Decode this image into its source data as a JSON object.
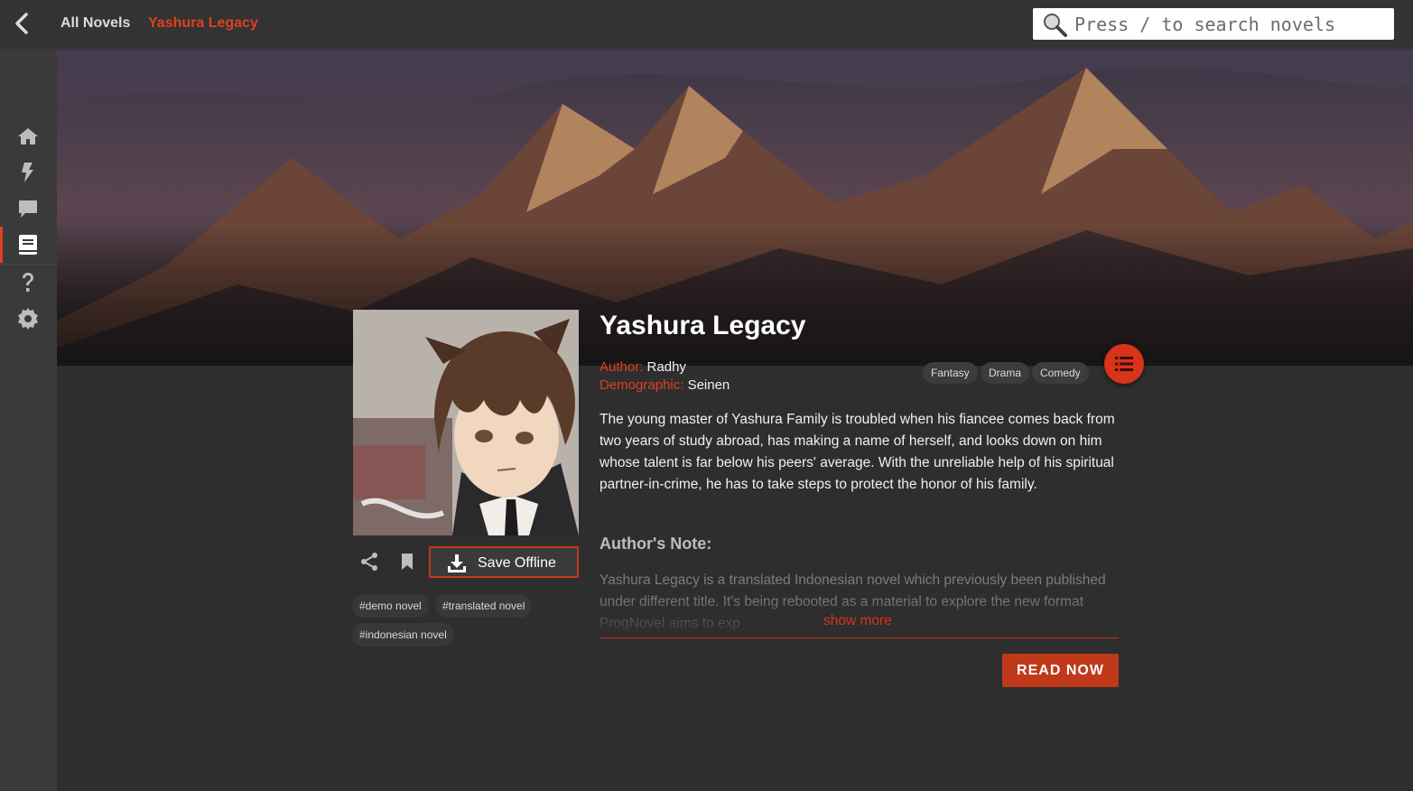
{
  "topbar": {
    "back_icon": "chevron-left-icon",
    "breadcrumb": {
      "all": "All Novels",
      "current": "Yashura Legacy"
    },
    "search": {
      "placeholder": "Press / to search novels",
      "value": ""
    }
  },
  "sidebar": {
    "items": [
      {
        "name": "home",
        "icon": "home-icon"
      },
      {
        "name": "updates",
        "icon": "lightning-icon"
      },
      {
        "name": "comments",
        "icon": "chat-icon"
      },
      {
        "name": "novels",
        "icon": "book-icon",
        "active": true
      },
      {
        "name": "help",
        "icon": "question-icon"
      },
      {
        "name": "settings",
        "icon": "gear-icon"
      }
    ]
  },
  "novel": {
    "title": "Yashura Legacy",
    "author_label": "Author:",
    "author": "Radhy",
    "demographic_label": "Demographic:",
    "demographic": "Seinen",
    "genres": [
      "Fantasy",
      "Drama",
      "Comedy"
    ],
    "synopsis": "The young master of Yashura Family is troubled when his fiancee comes back from two years of study abroad, has making a name of herself, and looks down on him whose talent is far below his peers' average. With the unreliable help of his spiritual partner-in-crime, he has to take steps to protect the honor of his family.",
    "author_note_heading": "Author's Note:",
    "author_note": "Yashura Legacy is a translated Indonesian novel which previously been published under different title. It's being rebooted as a material to explore the new format ProgNovel aims to exp",
    "show_more": "show more",
    "read_now": "READ NOW",
    "save_offline": "Save Offline",
    "tags": [
      "#demo novel",
      "#translated novel",
      "#indonesian novel"
    ]
  },
  "colors": {
    "accent": "#e0401e",
    "button": "#c0391b",
    "background": "#2e2e2e",
    "sidebar": "#3a3a3a"
  }
}
